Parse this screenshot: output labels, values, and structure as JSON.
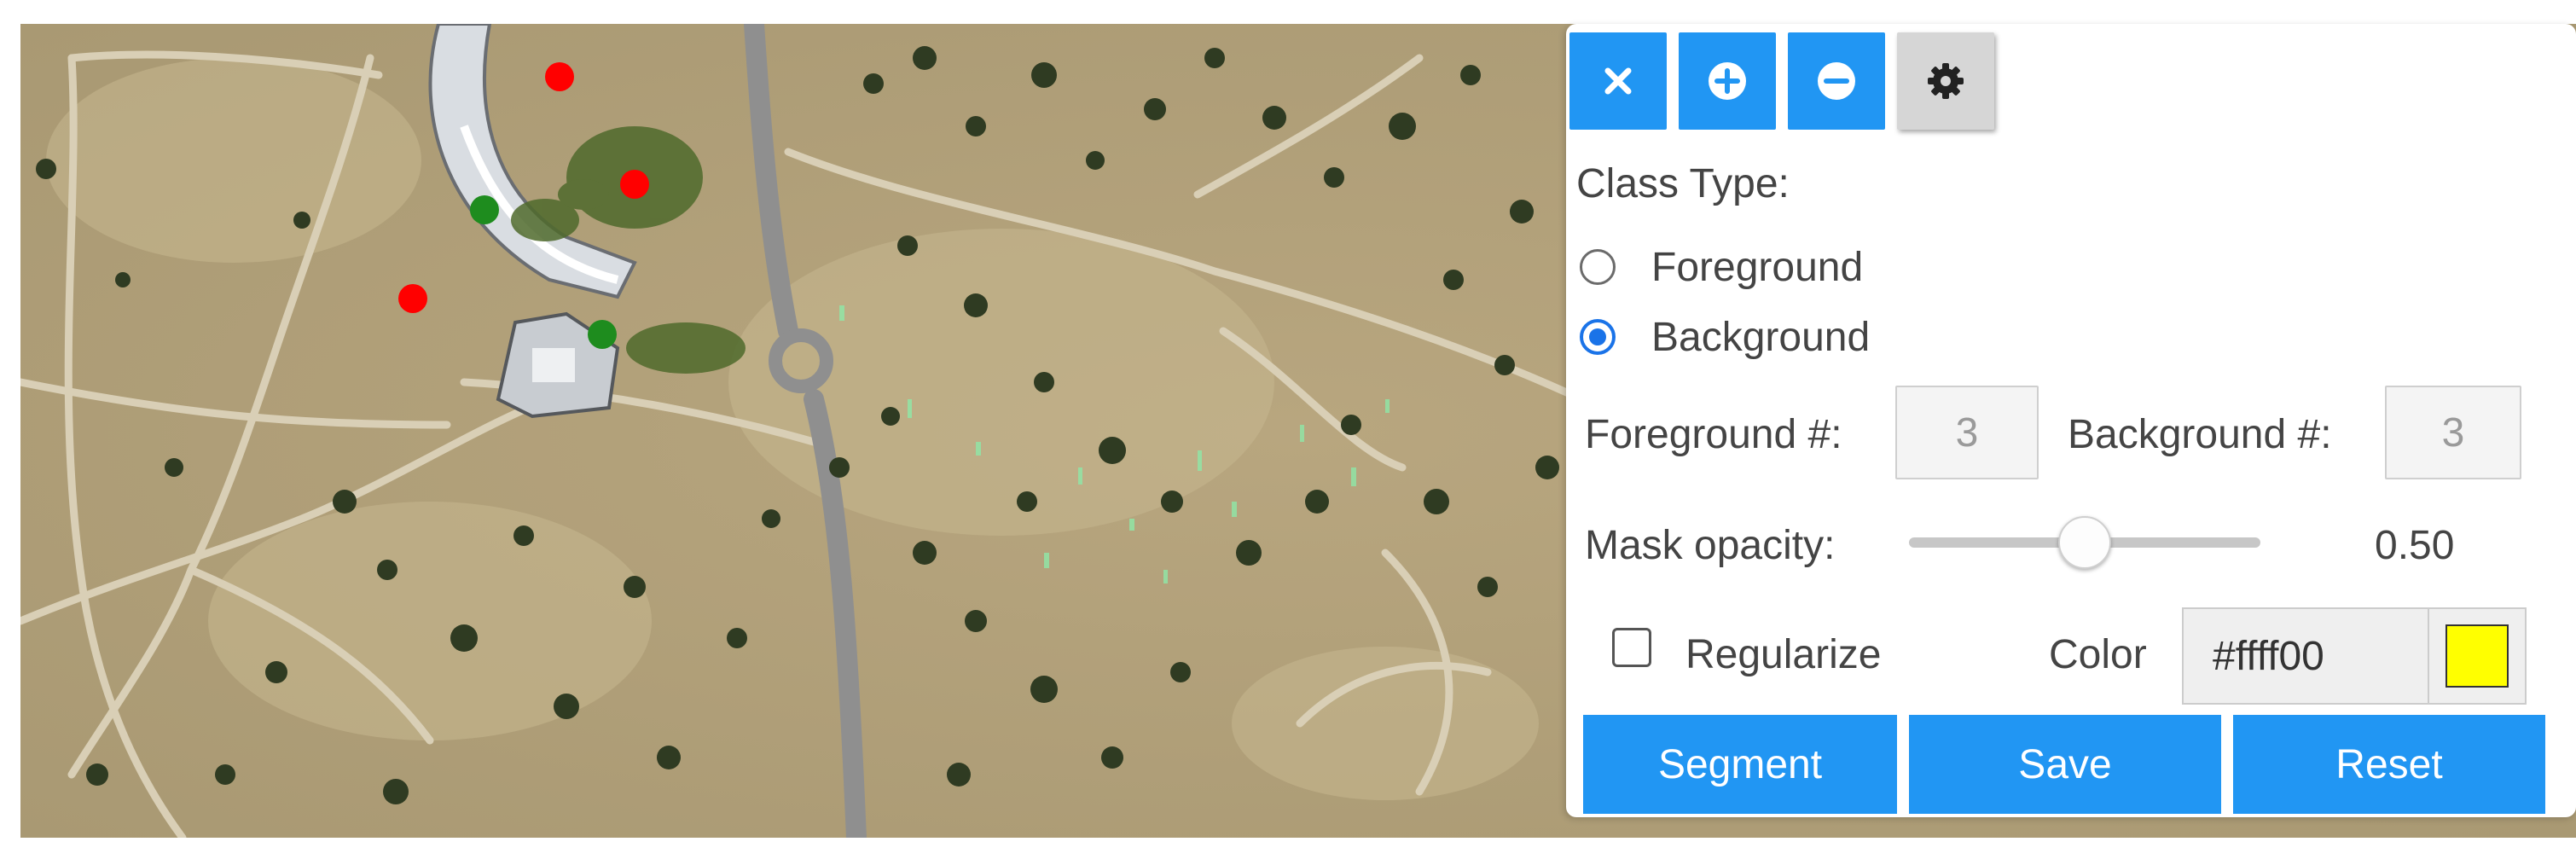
{
  "toolbar": {
    "buttons": [
      {
        "name": "close",
        "icon": "close-icon"
      },
      {
        "name": "zoom-in",
        "icon": "plus-circle-icon"
      },
      {
        "name": "zoom-out",
        "icon": "minus-circle-icon"
      },
      {
        "name": "settings",
        "icon": "gear-icon"
      }
    ]
  },
  "class_type": {
    "label": "Class Type:",
    "options": [
      {
        "label": "Foreground",
        "checked": false
      },
      {
        "label": "Background",
        "checked": true
      }
    ]
  },
  "counts": {
    "foreground_label": "Foreground #:",
    "foreground_value": "3",
    "background_label": "Background #:",
    "background_value": "3"
  },
  "mask_opacity": {
    "label": "Mask opacity:",
    "value": "0.50",
    "level": 0.5
  },
  "regularize": {
    "label": "Regularize",
    "checked": false
  },
  "color": {
    "label": "Color",
    "value": "#ffff00"
  },
  "actions": {
    "segment": "Segment",
    "save": "Save",
    "reset": "Reset"
  },
  "markers": {
    "foreground_color": "#ff0000",
    "background_color": "#1e8c1e"
  },
  "colors": {
    "accent": "#2196f3",
    "radio_selected": "#1a73e8",
    "mask_swatch": "#ffff00"
  }
}
